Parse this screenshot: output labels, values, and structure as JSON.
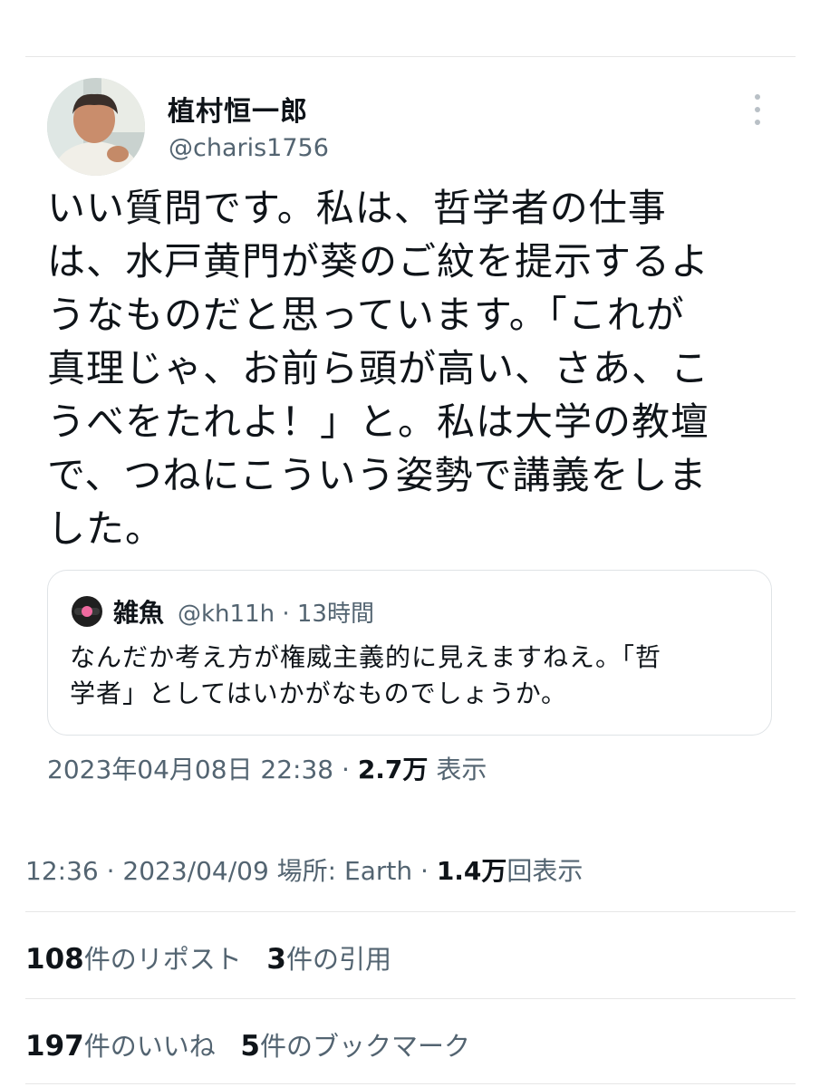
{
  "author": {
    "name": "植村恒一郎",
    "handle": "@charis1756"
  },
  "tweet": {
    "text": "いい質問です。私は、哲学者の仕事\nは、水戸黄門が葵のご紋を提示するよ\nうなものだと思っています。「これが\n真理じゃ、お前ら頭が高い、さあ、こ\nうべをたれよ！」と。私は大学の教壇\nで、つねにこういう姿勢で講義をしま\nした。"
  },
  "quoted": {
    "name": "雑魚",
    "meta": "@kh11h · 13時間",
    "text": "なんだか考え方が権威主義的に見えますねえ。「哲\n学者」としてはいかがなものでしょうか。"
  },
  "quote_stamp": {
    "datetime": "2023年04月08日 22:38 · ",
    "views": "2.7万",
    "views_label": " 表示"
  },
  "meta": {
    "time": "12:36 · 2023/04/09 場所: Earth · ",
    "views": "1.4万",
    "views_label": "回表示"
  },
  "stats": {
    "reposts_count": "108",
    "reposts_label": "件のリポスト",
    "quotes_count": "3",
    "quotes_label": "件の引用",
    "likes_count": "197",
    "likes_label": "件のいいね",
    "bookmarks_count": "5",
    "bookmarks_label": "件のブックマーク"
  },
  "icons": {
    "more": "more-vertical-icon",
    "quoted_avatar": "quoted-avatar-icon"
  },
  "colors": {
    "text": "#0f1419",
    "secondary": "#536471",
    "divider": "#e6e6e6"
  }
}
